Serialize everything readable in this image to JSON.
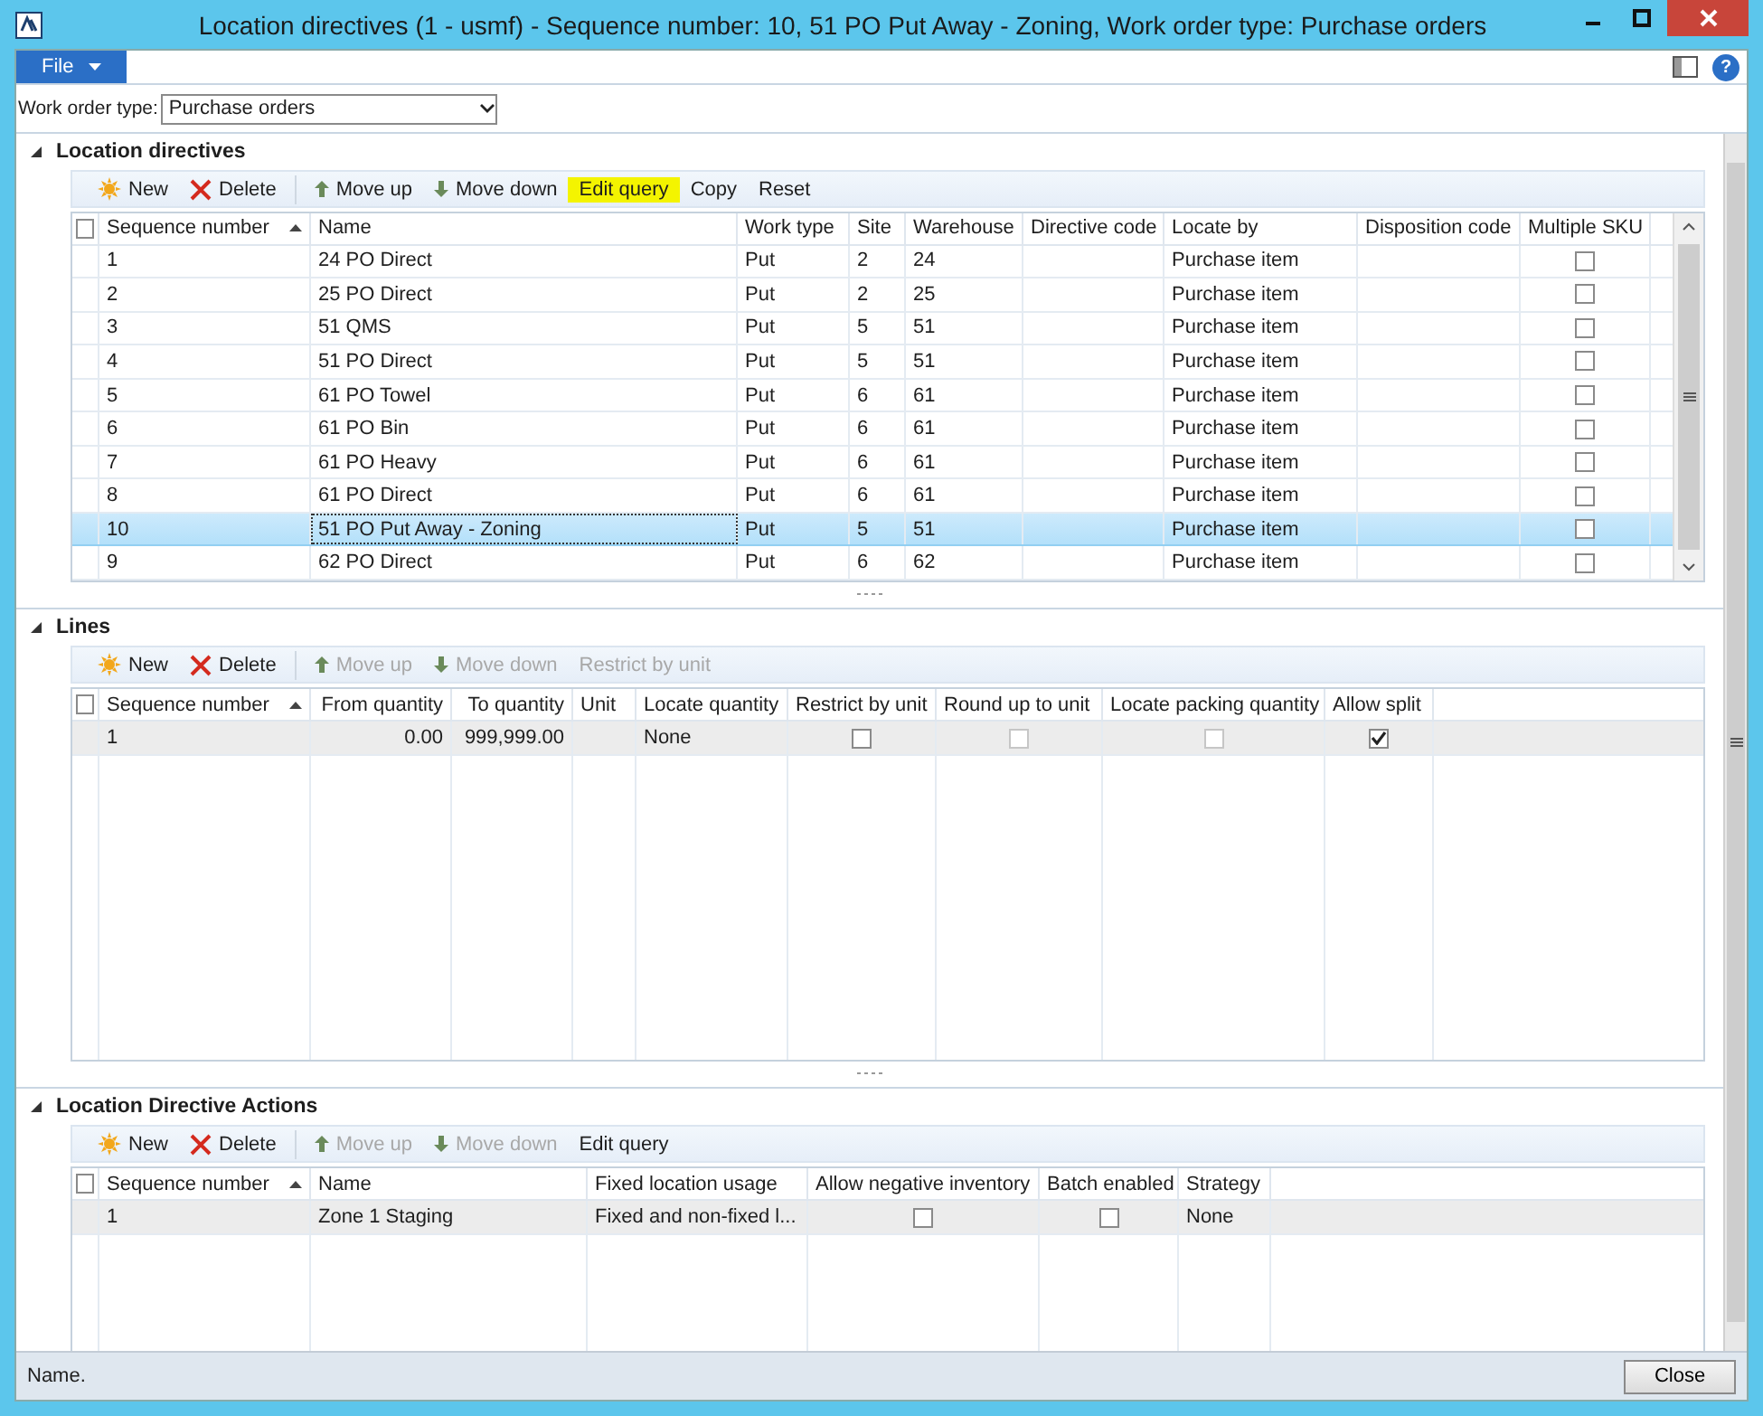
{
  "window": {
    "title": "Location directives (1 - usmf) - Sequence number: 10, 51 PO Put Away - Zoning, Work order type: Purchase orders"
  },
  "menu": {
    "file": "File",
    "help": "?"
  },
  "filter": {
    "label": "Work order type:",
    "value": "Purchase orders"
  },
  "sections": [
    {
      "title": "Location directives",
      "expanded": true,
      "focused": true,
      "select_all_checked": false,
      "toolbar": [
        {
          "label": "New",
          "kind": "new",
          "disabled": false,
          "highlighted": false
        },
        {
          "label": "Delete",
          "kind": "delete",
          "disabled": false,
          "highlighted": false
        },
        {
          "label": "Move up",
          "kind": "up",
          "disabled": false,
          "highlighted": false
        },
        {
          "label": "Move down",
          "kind": "down",
          "disabled": false,
          "highlighted": false
        },
        {
          "label": "Edit query",
          "kind": "plain",
          "disabled": false,
          "highlighted": true
        },
        {
          "label": "Copy",
          "kind": "plain",
          "disabled": false,
          "highlighted": false
        },
        {
          "label": "Reset",
          "kind": "plain",
          "disabled": false,
          "highlighted": false
        }
      ],
      "columns": [
        {
          "label": "Sequence number",
          "sorted": true,
          "kind": "text"
        },
        {
          "label": "Name",
          "sorted": false,
          "kind": "text"
        },
        {
          "label": "Work type",
          "sorted": false,
          "kind": "text"
        },
        {
          "label": "Site",
          "sorted": false,
          "kind": "text"
        },
        {
          "label": "Warehouse",
          "sorted": false,
          "kind": "text"
        },
        {
          "label": "Directive code",
          "sorted": false,
          "kind": "text"
        },
        {
          "label": "Locate by",
          "sorted": false,
          "kind": "text"
        },
        {
          "label": "Disposition code",
          "sorted": false,
          "kind": "text"
        },
        {
          "label": "Multiple SKU",
          "sorted": false,
          "kind": "check"
        }
      ],
      "rows": [
        {
          "selected": false,
          "cells": [
            {
              "kind": "text",
              "text": "1"
            },
            {
              "kind": "text",
              "text": "24 PO Direct"
            },
            {
              "kind": "text",
              "text": "Put"
            },
            {
              "kind": "text",
              "text": "2"
            },
            {
              "kind": "text",
              "text": "24"
            },
            {
              "kind": "empty"
            },
            {
              "kind": "text",
              "text": "Purchase item"
            },
            {
              "kind": "empty"
            },
            {
              "kind": "checkbox",
              "checked": false,
              "disabled": false
            }
          ]
        },
        {
          "selected": false,
          "cells": [
            {
              "kind": "text",
              "text": "2"
            },
            {
              "kind": "text",
              "text": "25 PO Direct"
            },
            {
              "kind": "text",
              "text": "Put"
            },
            {
              "kind": "text",
              "text": "2"
            },
            {
              "kind": "text",
              "text": "25"
            },
            {
              "kind": "empty"
            },
            {
              "kind": "text",
              "text": "Purchase item"
            },
            {
              "kind": "empty"
            },
            {
              "kind": "checkbox",
              "checked": false,
              "disabled": false
            }
          ]
        },
        {
          "selected": false,
          "cells": [
            {
              "kind": "text",
              "text": "3"
            },
            {
              "kind": "text",
              "text": "51 QMS"
            },
            {
              "kind": "text",
              "text": "Put"
            },
            {
              "kind": "text",
              "text": "5"
            },
            {
              "kind": "text",
              "text": "51"
            },
            {
              "kind": "empty"
            },
            {
              "kind": "text",
              "text": "Purchase item"
            },
            {
              "kind": "empty"
            },
            {
              "kind": "checkbox",
              "checked": false,
              "disabled": false
            }
          ]
        },
        {
          "selected": false,
          "cells": [
            {
              "kind": "text",
              "text": "4"
            },
            {
              "kind": "text",
              "text": "51 PO Direct"
            },
            {
              "kind": "text",
              "text": "Put"
            },
            {
              "kind": "text",
              "text": "5"
            },
            {
              "kind": "text",
              "text": "51"
            },
            {
              "kind": "empty"
            },
            {
              "kind": "text",
              "text": "Purchase item"
            },
            {
              "kind": "empty"
            },
            {
              "kind": "checkbox",
              "checked": false,
              "disabled": false
            }
          ]
        },
        {
          "selected": false,
          "cells": [
            {
              "kind": "text",
              "text": "5"
            },
            {
              "kind": "text",
              "text": "61 PO Towel"
            },
            {
              "kind": "text",
              "text": "Put"
            },
            {
              "kind": "text",
              "text": "6"
            },
            {
              "kind": "text",
              "text": "61"
            },
            {
              "kind": "empty"
            },
            {
              "kind": "text",
              "text": "Purchase item"
            },
            {
              "kind": "empty"
            },
            {
              "kind": "checkbox",
              "checked": false,
              "disabled": false
            }
          ]
        },
        {
          "selected": false,
          "cells": [
            {
              "kind": "text",
              "text": "6"
            },
            {
              "kind": "text",
              "text": "61 PO Bin"
            },
            {
              "kind": "text",
              "text": "Put"
            },
            {
              "kind": "text",
              "text": "6"
            },
            {
              "kind": "text",
              "text": "61"
            },
            {
              "kind": "empty"
            },
            {
              "kind": "text",
              "text": "Purchase item"
            },
            {
              "kind": "empty"
            },
            {
              "kind": "checkbox",
              "checked": false,
              "disabled": false
            }
          ]
        },
        {
          "selected": false,
          "cells": [
            {
              "kind": "text",
              "text": "7"
            },
            {
              "kind": "text",
              "text": "61 PO Heavy"
            },
            {
              "kind": "text",
              "text": "Put"
            },
            {
              "kind": "text",
              "text": "6"
            },
            {
              "kind": "text",
              "text": "61"
            },
            {
              "kind": "empty"
            },
            {
              "kind": "text",
              "text": "Purchase item"
            },
            {
              "kind": "empty"
            },
            {
              "kind": "checkbox",
              "checked": false,
              "disabled": false
            }
          ]
        },
        {
          "selected": false,
          "cells": [
            {
              "kind": "text",
              "text": "8"
            },
            {
              "kind": "text",
              "text": "61 PO Direct"
            },
            {
              "kind": "text",
              "text": "Put"
            },
            {
              "kind": "text",
              "text": "6"
            },
            {
              "kind": "text",
              "text": "61"
            },
            {
              "kind": "empty"
            },
            {
              "kind": "text",
              "text": "Purchase item"
            },
            {
              "kind": "empty"
            },
            {
              "kind": "checkbox",
              "checked": false,
              "disabled": false
            }
          ]
        },
        {
          "selected": true,
          "cells": [
            {
              "kind": "text",
              "text": "10"
            },
            {
              "kind": "text",
              "text": "51 PO Put Away - Zoning",
              "focused": true
            },
            {
              "kind": "text",
              "text": "Put"
            },
            {
              "kind": "text",
              "text": "5"
            },
            {
              "kind": "text",
              "text": "51"
            },
            {
              "kind": "empty"
            },
            {
              "kind": "text",
              "text": "Purchase item"
            },
            {
              "kind": "empty"
            },
            {
              "kind": "checkbox",
              "checked": false,
              "disabled": false
            }
          ]
        },
        {
          "selected": false,
          "cells": [
            {
              "kind": "text",
              "text": "9"
            },
            {
              "kind": "text",
              "text": "62 PO Direct"
            },
            {
              "kind": "text",
              "text": "Put"
            },
            {
              "kind": "text",
              "text": "6"
            },
            {
              "kind": "text",
              "text": "62"
            },
            {
              "kind": "empty"
            },
            {
              "kind": "text",
              "text": "Purchase item"
            },
            {
              "kind": "empty"
            },
            {
              "kind": "checkbox",
              "checked": false,
              "disabled": false
            }
          ]
        }
      ]
    },
    {
      "title": "Lines",
      "expanded": true,
      "focused": false,
      "select_all_checked": false,
      "toolbar": [
        {
          "label": "New",
          "kind": "new",
          "disabled": false,
          "highlighted": false
        },
        {
          "label": "Delete",
          "kind": "delete",
          "disabled": false,
          "highlighted": false
        },
        {
          "label": "Move up",
          "kind": "up",
          "disabled": true,
          "highlighted": false
        },
        {
          "label": "Move down",
          "kind": "down",
          "disabled": true,
          "highlighted": false
        },
        {
          "label": "Restrict by unit",
          "kind": "plain",
          "disabled": true,
          "highlighted": false
        }
      ],
      "columns": [
        {
          "label": "Sequence number",
          "sorted": true,
          "kind": "text"
        },
        {
          "label": "From quantity",
          "sorted": false,
          "kind": "number"
        },
        {
          "label": "To quantity",
          "sorted": false,
          "kind": "number"
        },
        {
          "label": "Unit",
          "sorted": false,
          "kind": "text"
        },
        {
          "label": "Locate quantity",
          "sorted": false,
          "kind": "text"
        },
        {
          "label": "Restrict by unit",
          "sorted": false,
          "kind": "check"
        },
        {
          "label": "Round up to unit",
          "sorted": false,
          "kind": "check"
        },
        {
          "label": "Locate packing quantity",
          "sorted": false,
          "kind": "check"
        },
        {
          "label": "Allow split",
          "sorted": false,
          "kind": "check"
        }
      ],
      "rows": [
        {
          "selected": true,
          "cells": [
            {
              "kind": "text",
              "text": "1"
            },
            {
              "kind": "text",
              "text": "0.00"
            },
            {
              "kind": "text",
              "text": "999,999.00"
            },
            {
              "kind": "empty"
            },
            {
              "kind": "text",
              "text": "None"
            },
            {
              "kind": "checkbox",
              "checked": false,
              "disabled": false
            },
            {
              "kind": "checkbox",
              "checked": false,
              "disabled": true
            },
            {
              "kind": "checkbox",
              "checked": false,
              "disabled": true
            },
            {
              "kind": "checkbox",
              "checked": true,
              "disabled": false
            }
          ]
        }
      ]
    },
    {
      "title": "Location Directive Actions",
      "expanded": true,
      "focused": false,
      "select_all_checked": false,
      "toolbar": [
        {
          "label": "New",
          "kind": "new",
          "disabled": false,
          "highlighted": false
        },
        {
          "label": "Delete",
          "kind": "delete",
          "disabled": false,
          "highlighted": false
        },
        {
          "label": "Move up",
          "kind": "up",
          "disabled": true,
          "highlighted": false
        },
        {
          "label": "Move down",
          "kind": "down",
          "disabled": true,
          "highlighted": false
        },
        {
          "label": "Edit query",
          "kind": "plain",
          "disabled": false,
          "highlighted": false
        }
      ],
      "columns": [
        {
          "label": "Sequence number",
          "sorted": true,
          "kind": "text"
        },
        {
          "label": "Name",
          "sorted": false,
          "kind": "text"
        },
        {
          "label": "Fixed location usage",
          "sorted": false,
          "kind": "text"
        },
        {
          "label": "Allow negative inventory",
          "sorted": false,
          "kind": "check"
        },
        {
          "label": "Batch enabled",
          "sorted": false,
          "kind": "check"
        },
        {
          "label": "Strategy",
          "sorted": false,
          "kind": "text"
        }
      ],
      "rows": [
        {
          "selected": true,
          "cells": [
            {
              "kind": "text",
              "text": "1"
            },
            {
              "kind": "text",
              "text": "Zone 1 Staging"
            },
            {
              "kind": "text",
              "text": "Fixed and non-fixed l..."
            },
            {
              "kind": "checkbox",
              "checked": false,
              "disabled": false
            },
            {
              "kind": "checkbox",
              "checked": false,
              "disabled": false
            },
            {
              "kind": "text",
              "text": "None"
            }
          ]
        }
      ]
    }
  ],
  "status_bar": {
    "text": "Name.",
    "button": "Close"
  }
}
